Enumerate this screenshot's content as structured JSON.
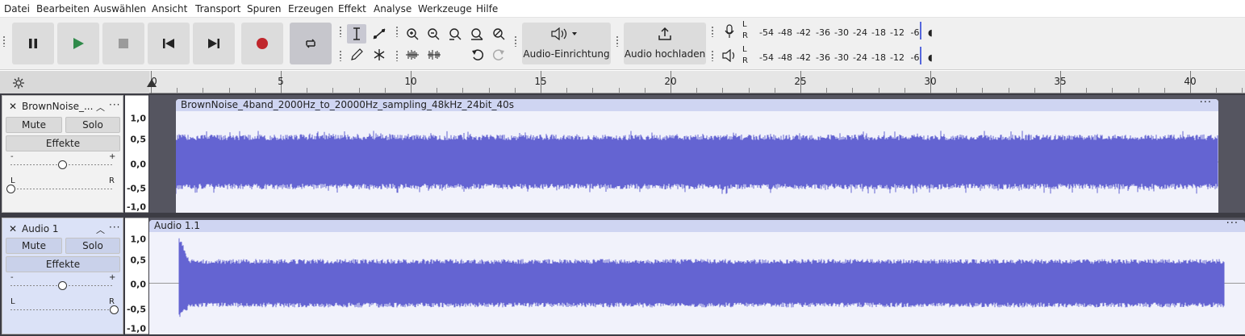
{
  "menu": [
    "Datei",
    "Bearbeiten",
    "Auswählen",
    "Ansicht",
    "Transport",
    "Spuren",
    "Erzeugen",
    "Effekt",
    "Analyse",
    "Werkzeuge",
    "Hilfe"
  ],
  "toolbar": {
    "audio_setup_label": "Audio-Einrichtung",
    "share_label": "Audio hochladen",
    "record_meter_channels": [
      "L",
      "R"
    ],
    "playback_meter_channels": [
      "L",
      "R"
    ],
    "meter_ticks": [
      "-54",
      "-48",
      "-42",
      "-36",
      "-30",
      "-24",
      "-18",
      "-12",
      "-6"
    ],
    "colors": {
      "record": "#c0262c",
      "play": "#2f8a4a",
      "accent": "#5566dd"
    }
  },
  "ruler": {
    "labels": [
      "0",
      "5",
      "10",
      "15",
      "20",
      "25",
      "30",
      "35",
      "40"
    ]
  },
  "tracks": [
    {
      "name": "BrownNoise_...",
      "mute": "Mute",
      "solo": "Solo",
      "effects": "Effekte",
      "gain_minus": "-",
      "gain_plus": "+",
      "pan_left": "L",
      "pan_right": "R",
      "gain_level": 0.5,
      "pan_level": 0.0,
      "selected": false,
      "scale": [
        "1,0",
        "0,5",
        "0,0",
        "-0,5",
        "-1,0"
      ],
      "clip_name": "BrownNoise_4band_2000Hz_to_20000Hz_sampling_48kHz_24bit_40s",
      "wave_color": "#6464d2"
    },
    {
      "name": "Audio 1",
      "mute": "Mute",
      "solo": "Solo",
      "effects": "Effekte",
      "gain_minus": "-",
      "gain_plus": "+",
      "pan_left": "L",
      "pan_right": "R",
      "gain_level": 0.5,
      "pan_level": 1.0,
      "selected": true,
      "scale": [
        "1,0",
        "0,5",
        "0,0",
        "-0,5",
        "-1,0"
      ],
      "clip_name": "Audio 1.1",
      "wave_color": "#6464d2"
    }
  ]
}
